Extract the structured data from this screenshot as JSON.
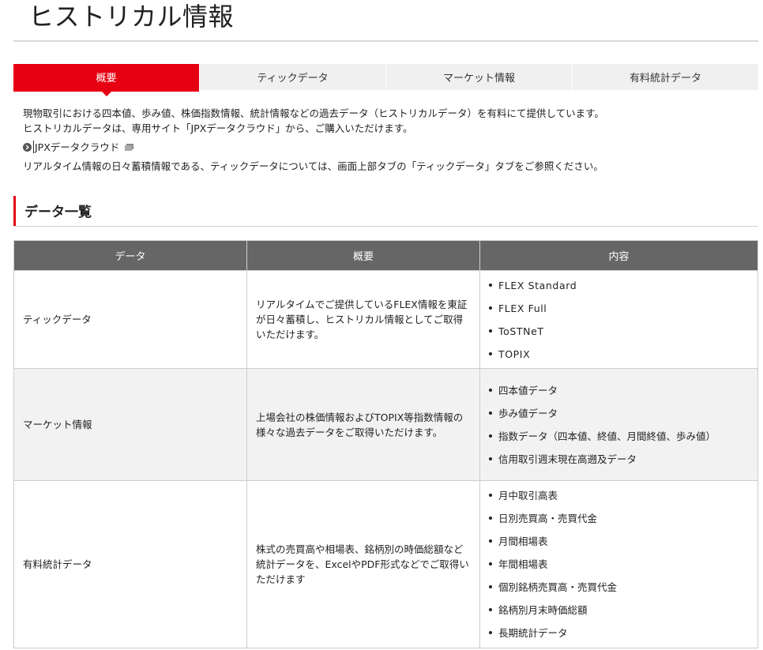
{
  "page": {
    "title": "ヒストリカル情報"
  },
  "tabs": [
    {
      "label": "概要",
      "active": true
    },
    {
      "label": "ティックデータ",
      "active": false
    },
    {
      "label": "マーケット情報",
      "active": false
    },
    {
      "label": "有料統計データ",
      "active": false
    }
  ],
  "intro": {
    "line1": "現物取引における四本値、歩み値、株価指数情報、統計情報などの過去データ（ヒストリカルデータ）を有料にて提供しています。",
    "line2": "ヒストリカルデータは、専用サイト「JPXデータクラウド」から、ご購入いただけます。",
    "link_label": "JPXデータクラウド",
    "line3": "リアルタイム情報の日々蓄積情報である、ティックデータについては、画面上部タブの「ティックデータ」タブをご参照ください。"
  },
  "section": {
    "heading": "データ一覧"
  },
  "table": {
    "headers": [
      "データ",
      "概要",
      "内容"
    ],
    "rows": [
      {
        "data": "ティックデータ",
        "summary": "リアルタイムでご提供しているFLEX情報を東証が日々蓄積し、ヒストリカル情報としてご取得いただけます。",
        "contents": [
          "FLEX Standard",
          "FLEX Full",
          "ToSTNeT",
          "TOPIX"
        ]
      },
      {
        "data": "マーケット情報",
        "summary": "上場会社の株価情報およびTOPIX等指数情報の様々な過去データをご取得いただけます。",
        "contents": [
          "四本値データ",
          "歩み値データ",
          "指数データ（四本値、終値、月間終値、歩み値）",
          "信用取引週末現在高遡及データ"
        ]
      },
      {
        "data": "有料統計データ",
        "summary": "株式の売買高や相場表、銘柄別の時価総額など統計データを、ExcelやPDF形式などでご取得いただけます",
        "contents": [
          "月中取引高表",
          "日別売買高・売買代金",
          "月間相場表",
          "年間相場表",
          "個別銘柄売買高・売買代金",
          "銘柄別月末時価総額",
          "長期統計データ"
        ]
      }
    ]
  },
  "colors": {
    "accent": "#e60012",
    "header_bg": "#666666",
    "tab_bg": "#f0f0f0",
    "alt_row_bg": "#f2f2f2"
  },
  "icons": {
    "link_bullet": "chevron-right-circle-icon",
    "external": "external-window-icon"
  }
}
